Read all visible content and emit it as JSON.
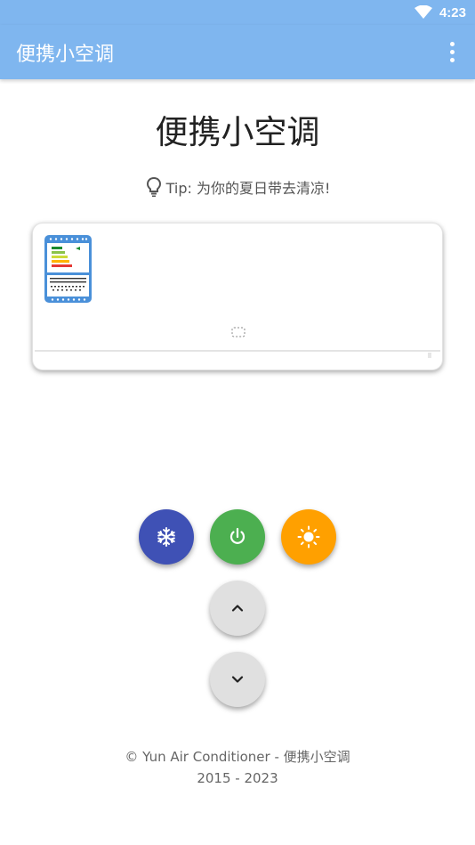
{
  "status_bar": {
    "time": "4:23",
    "wifi_icon": "wifi-icon"
  },
  "app_bar": {
    "title": "便携小空调",
    "menu_icon": "more-vert-icon"
  },
  "main": {
    "title": "便携小空调",
    "tip": "Tip: 为你的夏日带去清凉!",
    "tip_icon": "lightbulb-icon"
  },
  "ac_unit": {
    "label_icon": "energy-label-icon",
    "display_icon": "temperature-display-icon"
  },
  "controls": {
    "cool_icon": "snowflake-icon",
    "power_icon": "power-icon",
    "heat_icon": "sun-icon",
    "up_icon": "chevron-up-icon",
    "down_icon": "chevron-down-icon"
  },
  "colors": {
    "primary": "#7fb6ef",
    "cool": "#3f51b5",
    "power": "#4caf50",
    "heat": "#ffa000",
    "neutral": "#e0e0e0"
  },
  "footer": {
    "line1": "© Yun Air Conditioner - 便携小空调",
    "line2": "2015 - 2023"
  }
}
